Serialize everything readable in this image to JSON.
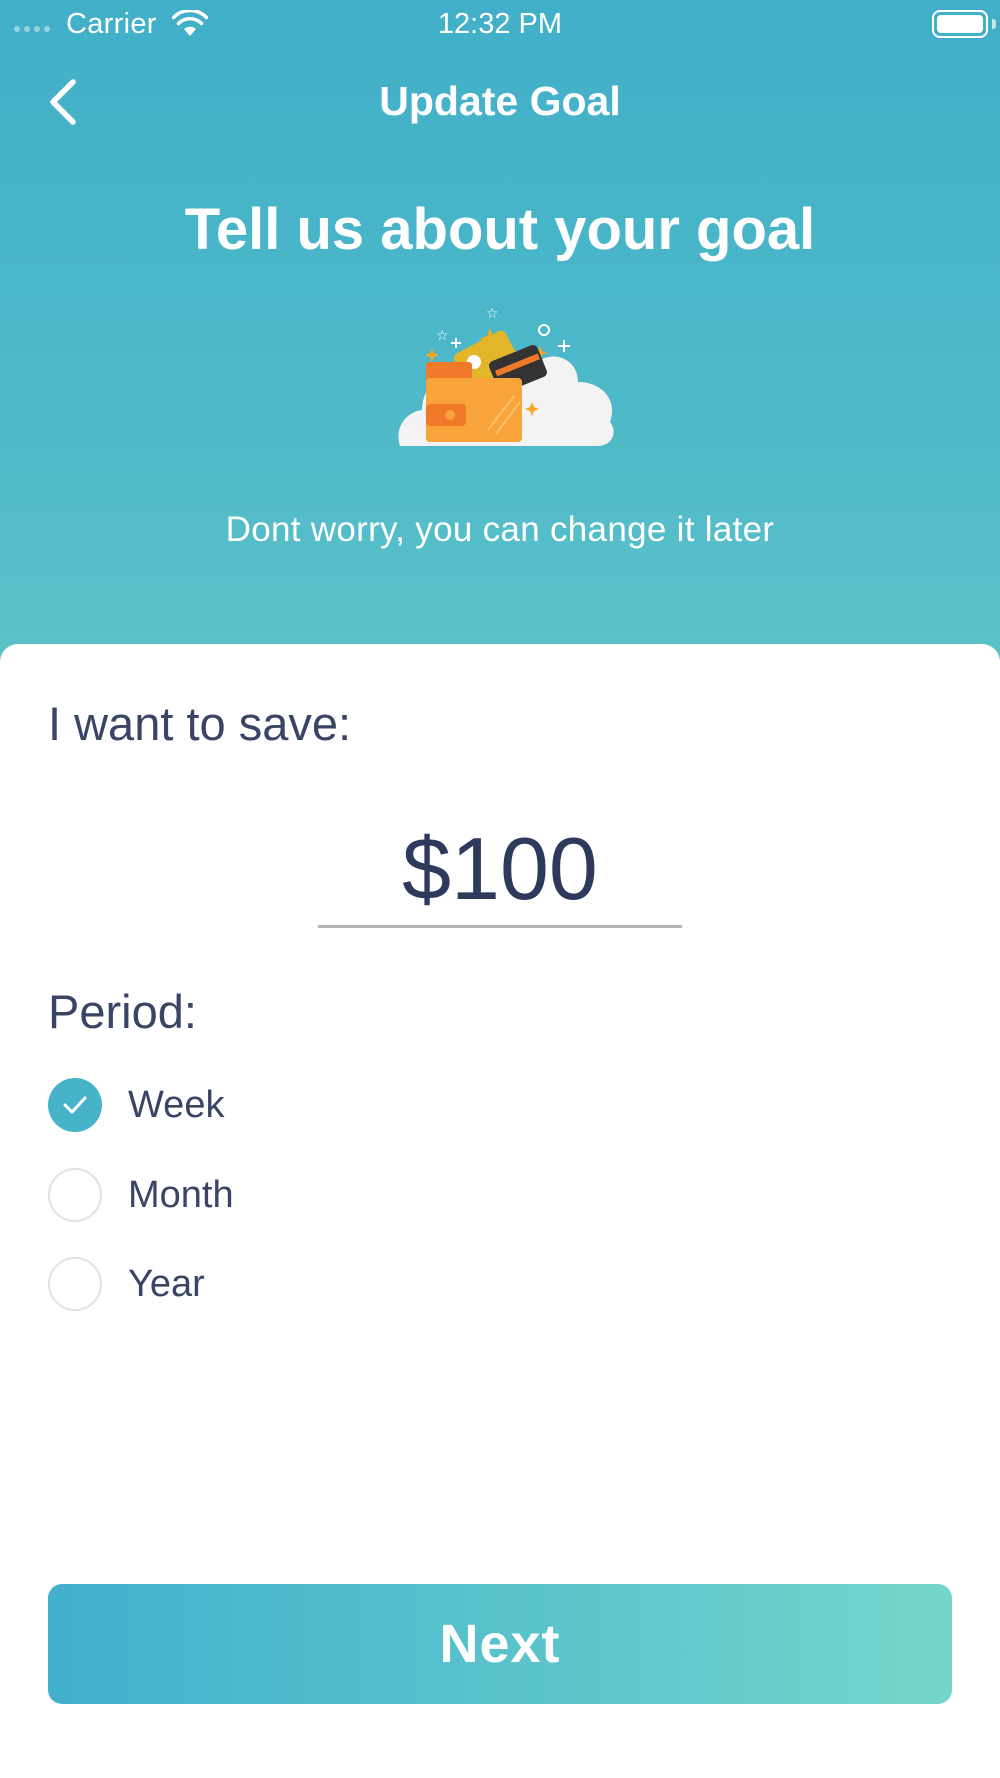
{
  "status_bar": {
    "carrier": "Carrier",
    "time": "12:32 PM"
  },
  "nav": {
    "title": "Update Goal",
    "back_icon": "chevron-left-icon"
  },
  "hero": {
    "headline": "Tell us about your goal",
    "illustration": "wallet-cards-cloud-illustration",
    "subtitle": "Dont worry, you can change it later"
  },
  "form": {
    "save_label": "I want to save:",
    "amount": "$100",
    "period_label": "Period:",
    "options": [
      {
        "label": "Week",
        "selected": true
      },
      {
        "label": "Month",
        "selected": false
      },
      {
        "label": "Year",
        "selected": false
      }
    ]
  },
  "actions": {
    "next_label": "Next"
  },
  "colors": {
    "accent": "#46b3c9",
    "header_top": "#41afc8",
    "header_bottom": "#5cc2c9",
    "text_dark": "#3a4565",
    "button_gradient_start": "#42b0ce",
    "button_gradient_end": "#74d5cb"
  }
}
